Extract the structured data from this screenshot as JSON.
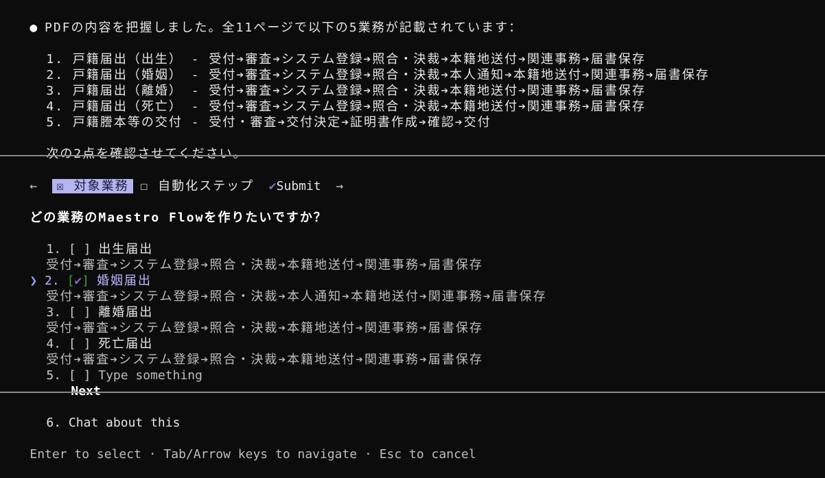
{
  "intro": {
    "bullet": "●",
    "summary": "PDFの内容を把握しました。全11ページで以下の5業務が記載されています：",
    "items": [
      "1. 戸籍届出（出生） - 受付➔審査➔システム登録➔照合・決裁➔本籍地送付➔関連事務➔届書保存",
      "2. 戸籍届出（婚姻） - 受付➔審査➔システム登録➔照合・決裁➔本人通知➔本籍地送付➔関連事務➔届書保存",
      "3. 戸籍届出（離婚） - 受付➔審査➔システム登録➔照合・決裁➔本籍地送付➔関連事務➔届書保存",
      "4. 戸籍届出（死亡） - 受付➔審査➔システム登録➔照合・決裁➔本籍地送付➔関連事務➔届書保存",
      "5. 戸籍謄本等の交付 - 受付・審査➔交付決定➔証明書作成➔確認➔交付"
    ],
    "confirm": "次の2点を確認させてください。"
  },
  "tabs": {
    "prev": "←",
    "tab1": "☒ 対象業務",
    "tab2": "☐ 自動化ステップ",
    "submit_check": "✔",
    "submit": "Submit",
    "next": "→"
  },
  "question": "どの業務のMaestro Flowを作りたいですか？",
  "options": [
    {
      "num": "1.",
      "box": "[ ]",
      "label": "出生届出",
      "desc": "受付➔審査➔システム登録➔照合・決裁➔本籍地送付➔関連事務➔届書保存"
    },
    {
      "num": "2.",
      "box_open": "[",
      "box_check": "✔",
      "box_close": "]",
      "label": "婚姻届出",
      "desc": "受付➔審査➔システム登録➔照合・決裁➔本人通知➔本籍地送付➔関連事務➔届書保存",
      "cursor": "❯"
    },
    {
      "num": "3.",
      "box": "[ ]",
      "label": "離婚届出",
      "desc": "受付➔審査➔システム登録➔照合・決裁➔本籍地送付➔関連事務➔届書保存"
    },
    {
      "num": "4.",
      "box": "[ ]",
      "label": "死亡届出",
      "desc": "受付➔審査➔システム登録➔照合・決裁➔本籍地送付➔関連事務➔届書保存"
    },
    {
      "num": "5.",
      "box": "[ ]",
      "label": "Type something"
    }
  ],
  "next_label": "Next",
  "chat": "6. Chat about this",
  "footer": "Enter to select · Tab/Arrow keys to navigate · Esc to cancel"
}
